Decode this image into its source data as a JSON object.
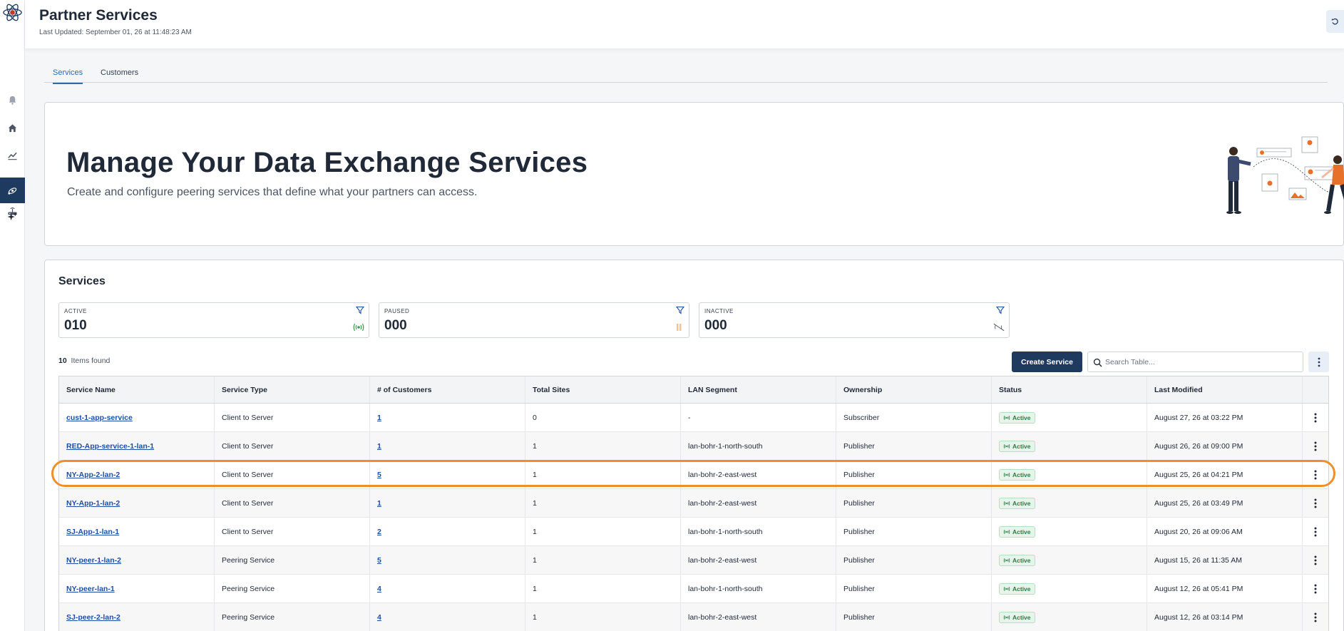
{
  "header": {
    "title": "Partner Services",
    "last_updated": "Last Updated: September 01, 26 at 11:48:23 AM"
  },
  "tabs": [
    {
      "label": "Services",
      "active": true
    },
    {
      "label": "Customers",
      "active": false
    }
  ],
  "hero": {
    "title": "Manage Your Data Exchange Services",
    "subtitle": "Create and configure peering services that define what your partners can access."
  },
  "services": {
    "title": "Services",
    "stats": [
      {
        "label": "ACTIVE",
        "value": "010",
        "icon": "broadcast-icon",
        "color": "#3a9a4a"
      },
      {
        "label": "PAUSED",
        "value": "000",
        "icon": "pause-icon",
        "color": "#f4c48a"
      },
      {
        "label": "INACTIVE",
        "value": "000",
        "icon": "broadcast-off-icon",
        "color": "#4b5563"
      }
    ],
    "items_count": "10",
    "items_label": "Items found",
    "create_label": "Create Service",
    "search_placeholder": "Search Table...",
    "columns": [
      "Service Name",
      "Service Type",
      "# of Customers",
      "Total Sites",
      "LAN Segment",
      "Ownership",
      "Status",
      "Last Modified"
    ],
    "rows": [
      {
        "name": "cust-1-app-service",
        "type": "Client to Server",
        "customers": "1",
        "sites": "0",
        "lan": "-",
        "ownership": "Subscriber",
        "status": "Active",
        "modified": "August 27, 26 at 03:22 PM"
      },
      {
        "name": "RED-App-service-1-lan-1",
        "type": "Client to Server",
        "customers": "1",
        "sites": "1",
        "lan": "lan-bohr-1-north-south",
        "ownership": "Publisher",
        "status": "Active",
        "modified": "August 26, 26 at 09:00 PM"
      },
      {
        "name": "NY-App-2-lan-2",
        "type": "Client to Server",
        "customers": "5",
        "sites": "1",
        "lan": "lan-bohr-2-east-west",
        "ownership": "Publisher",
        "status": "Active",
        "modified": "August 25, 26 at 04:21 PM"
      },
      {
        "name": "NY-App-1-lan-2",
        "type": "Client to Server",
        "customers": "1",
        "sites": "1",
        "lan": "lan-bohr-2-east-west",
        "ownership": "Publisher",
        "status": "Active",
        "modified": "August 25, 26 at 03:49 PM"
      },
      {
        "name": "SJ-App-1-lan-1",
        "type": "Client to Server",
        "customers": "2",
        "sites": "1",
        "lan": "lan-bohr-1-north-south",
        "ownership": "Publisher",
        "status": "Active",
        "modified": "August 20, 26 at 09:06 AM"
      },
      {
        "name": "NY-peer-1-lan-2",
        "type": "Peering Service",
        "customers": "5",
        "sites": "1",
        "lan": "lan-bohr-2-east-west",
        "ownership": "Publisher",
        "status": "Active",
        "modified": "August 15, 26 at 11:35 AM"
      },
      {
        "name": "NY-peer-lan-1",
        "type": "Peering Service",
        "customers": "4",
        "sites": "1",
        "lan": "lan-bohr-1-north-south",
        "ownership": "Publisher",
        "status": "Active",
        "modified": "August 12, 26 at 05:41 PM"
      },
      {
        "name": "SJ-peer-2-lan-2",
        "type": "Peering Service",
        "customers": "4",
        "sites": "1",
        "lan": "lan-bohr-2-east-west",
        "ownership": "Publisher",
        "status": "Active",
        "modified": "August 12, 26 at 03:14 PM"
      }
    ]
  },
  "sidebar": {
    "items": [
      {
        "icon": "bell-icon"
      },
      {
        "icon": "home-icon"
      },
      {
        "icon": "chart-icon"
      },
      {
        "icon": "gear-icon"
      },
      {
        "icon": "router-icon"
      },
      {
        "icon": "partner-services-icon",
        "active": true
      },
      {
        "icon": "sparkle-icon"
      }
    ]
  },
  "colors": {
    "accent": "#1e3a5f",
    "link": "#1e4fa5",
    "active_tab": "#2b6cb0",
    "highlight": "#ef8f2a",
    "status_active": "#2f7a43"
  }
}
